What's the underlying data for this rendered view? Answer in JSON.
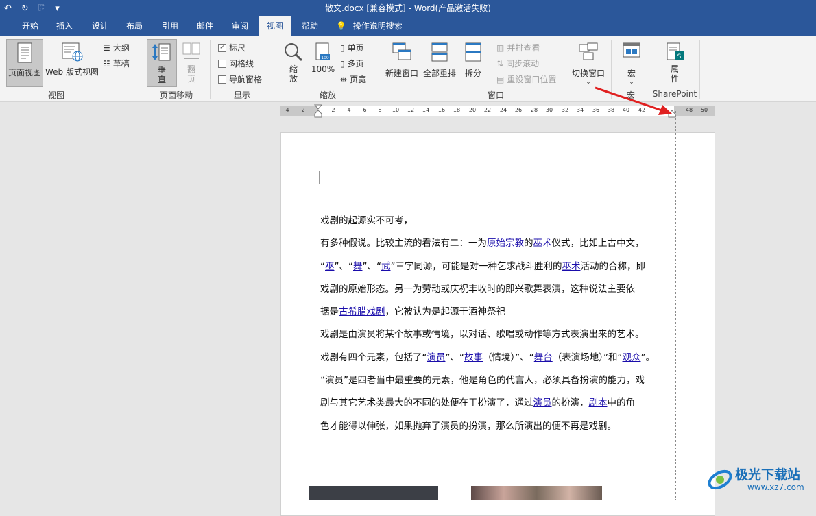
{
  "window": {
    "title": "散文.docx [兼容模式]  -  Word(产品激活失败)"
  },
  "quick_access": {
    "undo": "↶",
    "redo": "↻",
    "customize": "▾"
  },
  "tabs": [
    {
      "label": "开始"
    },
    {
      "label": "插入"
    },
    {
      "label": "设计"
    },
    {
      "label": "布局"
    },
    {
      "label": "引用"
    },
    {
      "label": "邮件"
    },
    {
      "label": "审阅"
    },
    {
      "label": "视图"
    },
    {
      "label": "帮助"
    }
  ],
  "active_tab": "视图",
  "tell_me": "操作说明搜索",
  "ribbon": {
    "views": {
      "print_layout": "页面视图",
      "web_layout": "Web 版式视图",
      "outline": "大纲",
      "draft": "草稿",
      "label": "视图"
    },
    "page_move": {
      "vertical": "垂直",
      "side": "翻页",
      "label": "页面移动"
    },
    "show": {
      "ruler": "标尺",
      "gridlines": "网格线",
      "nav_pane": "导航窗格",
      "label": "显示",
      "ruler_checked": true
    },
    "zoom": {
      "zoom": "缩放",
      "hundred": "100%",
      "one_page": "单页",
      "multi_page": "多页",
      "page_width": "页宽",
      "label": "缩放"
    },
    "window": {
      "new_window": "新建窗口",
      "arrange_all": "全部重排",
      "split": "拆分",
      "side_by_side": "并排查看",
      "sync_scroll": "同步滚动",
      "reset_pos": "重设窗口位置",
      "switch": "切换窗口",
      "label": "窗口"
    },
    "macros": {
      "macro": "宏",
      "label": "宏"
    },
    "sharepoint": {
      "properties": "属性",
      "label": "SharePoint"
    }
  },
  "ruler": {
    "ticks": [
      "4",
      "2",
      "2",
      "4",
      "6",
      "8",
      "10",
      "12",
      "14",
      "16",
      "18",
      "20",
      "22",
      "24",
      "26",
      "28",
      "30",
      "32",
      "34",
      "36",
      "38",
      "40",
      "42",
      "48",
      "50"
    ]
  },
  "document": {
    "lines": [
      [
        {
          "t": "戏剧的起源实不可考，"
        }
      ],
      [
        {
          "t": "有多种假说。比较主流的看法有二：一为"
        },
        {
          "t": "原始宗教",
          "l": true
        },
        {
          "t": "的"
        },
        {
          "t": "巫术",
          "l": true
        },
        {
          "t": "仪式，比如上古中文，"
        }
      ],
      [
        {
          "t": "“"
        },
        {
          "t": "巫",
          "l": true
        },
        {
          "t": "”、“"
        },
        {
          "t": "舞",
          "l": true
        },
        {
          "t": "”、“"
        },
        {
          "t": "武",
          "l": true
        },
        {
          "t": "”三字同源，可能是对一种乞求战斗胜利的"
        },
        {
          "t": "巫术",
          "l": true
        },
        {
          "t": "活动的合称，即"
        }
      ],
      [
        {
          "t": "戏剧的原始形态。另一为劳动或庆祝丰收时的即兴歌舞表演，这种说法主要依"
        }
      ],
      [
        {
          "t": "据是"
        },
        {
          "t": "古希腊戏剧",
          "l": true
        },
        {
          "t": "，它被认为是起源于酒神祭祀"
        }
      ],
      [
        {
          "t": "戏剧是由演员将某个故事或情境，以对话、歌唱或动作等方式表演出来的艺术。"
        }
      ],
      [
        {
          "t": "戏剧有四个元素，包括了“"
        },
        {
          "t": "演员",
          "l": true
        },
        {
          "t": "”、“"
        },
        {
          "t": "故事",
          "l": true
        },
        {
          "t": "（情境）”、“"
        },
        {
          "t": "舞台",
          "l": true
        },
        {
          "t": "（表演场地）”和“"
        },
        {
          "t": "观众",
          "l": true
        },
        {
          "t": "”。"
        }
      ],
      [
        {
          "t": "“演员”是四者当中最重要的元素，他是角色的代言人，必须具备扮演的能力，戏"
        }
      ],
      [
        {
          "t": "剧与其它艺术类最大的不同的处便在于扮演了，通过"
        },
        {
          "t": "演员",
          "l": true
        },
        {
          "t": "的扮演，"
        },
        {
          "t": "剧本",
          "l": true
        },
        {
          "t": "中的角"
        }
      ],
      [
        {
          "t": "色才能得以伸张，如果抛弃了演员的扮演，那么所演出的便不再是戏剧。"
        }
      ]
    ]
  },
  "watermark": {
    "name": "极光下载站",
    "url": "www.xz7.com"
  },
  "colors": {
    "brand": "#2b579a",
    "link": "#1a0dab",
    "arrow": "#e02020"
  }
}
